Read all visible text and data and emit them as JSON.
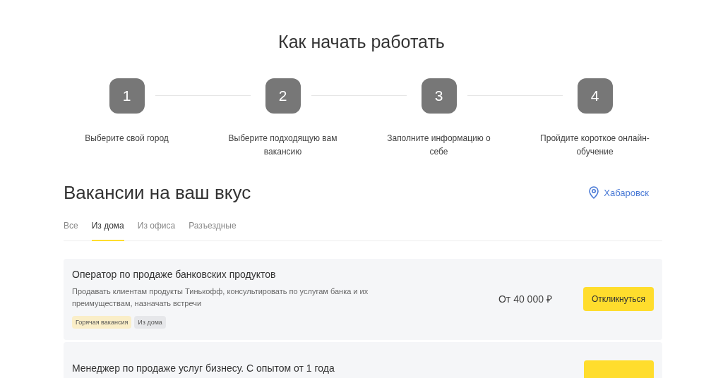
{
  "steps_section": {
    "title": "Как начать работать",
    "steps": [
      {
        "number": "1",
        "label": "Выберите свой город"
      },
      {
        "number": "2",
        "label": "Выберите подходящую вам вакансию"
      },
      {
        "number": "3",
        "label": "Заполните информацию о себе"
      },
      {
        "number": "4",
        "label": "Пройдите короткое онлайн-обучение"
      }
    ]
  },
  "vacancies": {
    "title": "Вакансии на ваш вкус",
    "city": "Хабаровск",
    "tabs": [
      {
        "label": "Все",
        "selected": false
      },
      {
        "label": "Из дома",
        "selected": true
      },
      {
        "label": "Из офиса",
        "selected": false
      },
      {
        "label": "Разъездные",
        "selected": false
      }
    ],
    "cards": [
      {
        "title": "Оператор по продаже банковских продуктов",
        "description": "Продавать клиентам продукты Тинькофф, консультировать по услугам банка и их преимуществам, назначать встречи",
        "tags": [
          {
            "label": "Горячая вакансия",
            "kind": "hot"
          },
          {
            "label": "Из дома",
            "kind": "plain"
          }
        ],
        "salary": "От 40 000 ₽",
        "button": "Откликнуться"
      },
      {
        "title": "Менеджер по продаже услуг бизнесу. С опытом от 1 года",
        "button_cut": true
      }
    ]
  }
}
